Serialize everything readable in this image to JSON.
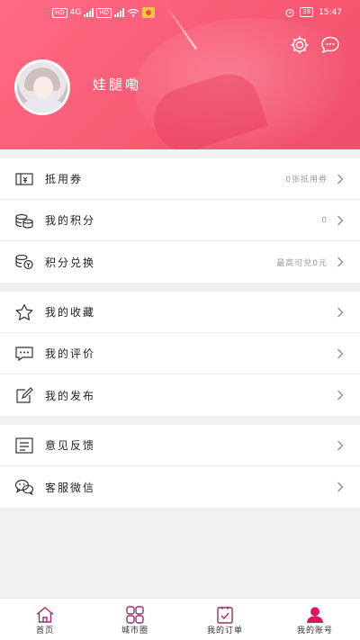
{
  "status_bar": {
    "left_tags": [
      "HD",
      "HD"
    ],
    "network": "4G",
    "time": "15:47",
    "battery": "38"
  },
  "profile": {
    "username": "娃腿嘞"
  },
  "menu": {
    "group1": [
      {
        "icon": "ticket-icon",
        "label": "抵用券",
        "value": "0张抵用券"
      },
      {
        "icon": "coins-icon",
        "label": "我的积分",
        "value": "0"
      },
      {
        "icon": "exchange-icon",
        "label": "积分兑换",
        "value": "最高可兑0元"
      }
    ],
    "group2": [
      {
        "icon": "star-icon",
        "label": "我的收藏",
        "value": ""
      },
      {
        "icon": "comment-icon",
        "label": "我的评价",
        "value": ""
      },
      {
        "icon": "edit-icon",
        "label": "我的发布",
        "value": ""
      }
    ],
    "group3": [
      {
        "icon": "feedback-icon",
        "label": "意见反馈",
        "value": ""
      },
      {
        "icon": "wechat-icon",
        "label": "客服微信",
        "value": ""
      }
    ]
  },
  "tabs": [
    {
      "label": "首页",
      "icon": "home-icon",
      "active": false
    },
    {
      "label": "城市圈",
      "icon": "grid-icon",
      "active": false
    },
    {
      "label": "我的订单",
      "icon": "order-icon",
      "active": false
    },
    {
      "label": "我的账号",
      "icon": "user-icon",
      "active": true
    }
  ],
  "colors": {
    "header_start": "#ff6b82",
    "header_end": "#ef4f6a",
    "tab_accent": "#9b2d6b",
    "active_tab": "#e0135e",
    "muted": "#9a9a9a"
  }
}
